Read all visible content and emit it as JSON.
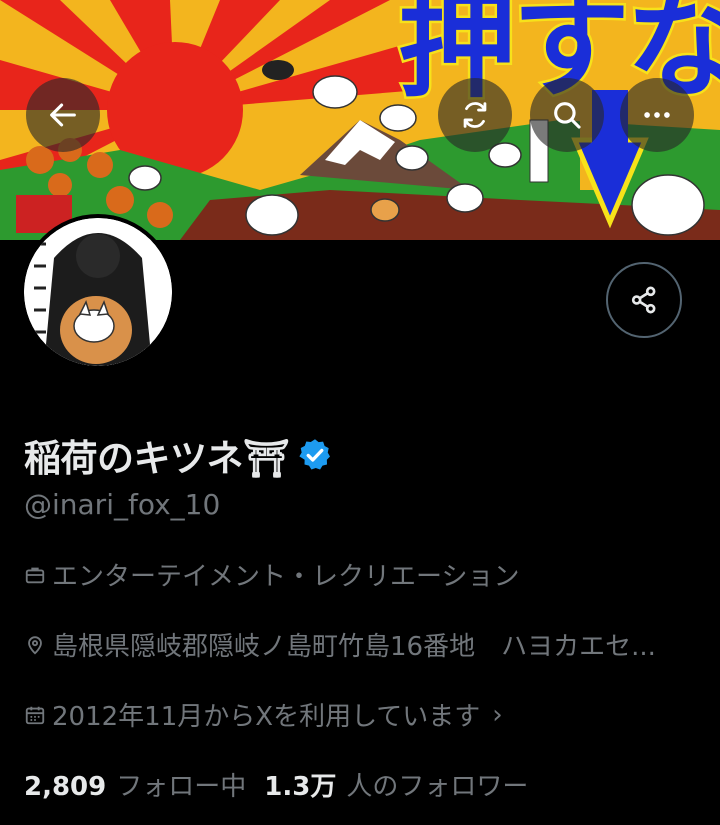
{
  "banner": {
    "headline": "押すな"
  },
  "header_buttons": {
    "back": "back-arrow-icon",
    "refresh": "refresh-icon",
    "search": "search-icon",
    "more": "more-icon"
  },
  "profile": {
    "display_name": "稲荷のキツネ⛩",
    "handle": "@inari_fox_10",
    "category": "エンターテイメント・レクリエーション",
    "location": "島根県隠岐郡隠岐ノ島町竹島16番地　ハヨカエセ...",
    "joined": "2012年11月からXを利用しています",
    "following_count": "2,809",
    "following_label": "フォロー中",
    "followers_count": "1.3万",
    "followers_label": "人のフォロワー"
  },
  "colors": {
    "background": "#000000",
    "primary_text": "#e7e9ea",
    "secondary_text": "#71767b",
    "verified": "#1d9bf0",
    "border": "#536471"
  }
}
